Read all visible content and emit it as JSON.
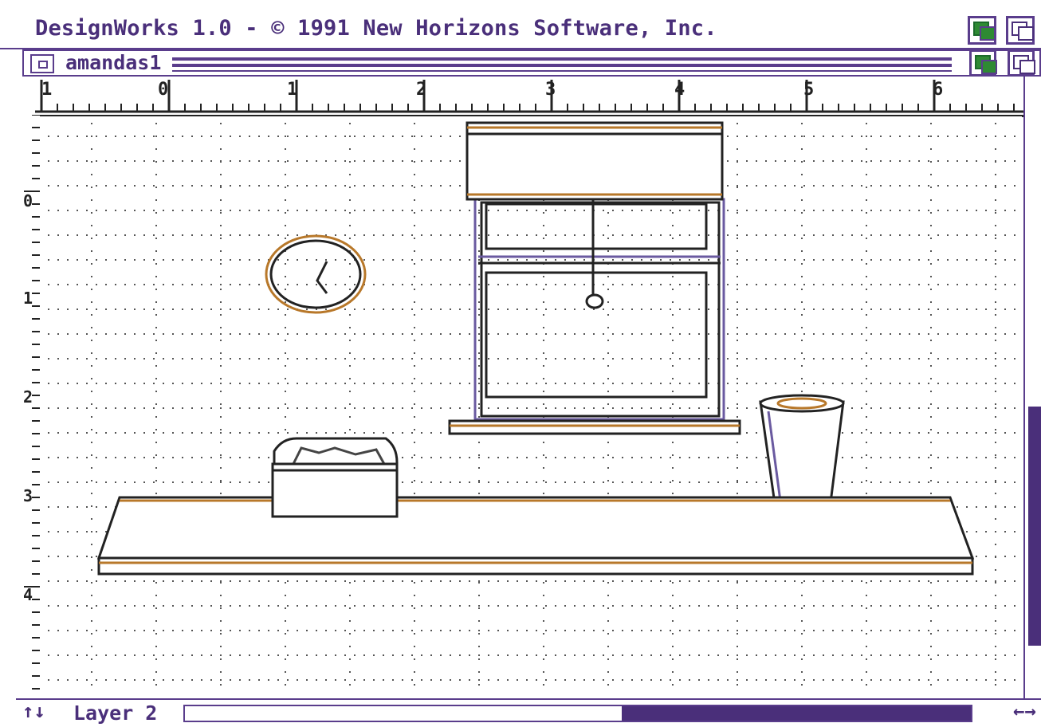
{
  "app": {
    "title": "DesignWorks 1.0 - © 1991 New Horizons Software, Inc."
  },
  "window": {
    "title": "amandas1"
  },
  "ruler": {
    "horizontal_labels": [
      "1",
      "0",
      "1",
      "2",
      "3",
      "4",
      "5",
      "6"
    ],
    "vertical_labels": [
      "0",
      "1",
      "2",
      "3",
      "4"
    ]
  },
  "status": {
    "layer_label": "Layer 2",
    "horizontal_scroll_position": 0.45,
    "vertical_scroll_position": 0.6
  },
  "icons": {
    "close": "close-icon",
    "depth": "depth-arrange-icon",
    "arrows_up_down": "up-down-arrows-icon",
    "arrows_left_right": "left-right-arrows-icon"
  },
  "colors": {
    "chrome": "#5a3d8c",
    "chrome_dark": "#4a2f7a",
    "accent_green": "#2e8a33",
    "drawing_line": "#222222",
    "drawing_accent": "#b8782a"
  }
}
